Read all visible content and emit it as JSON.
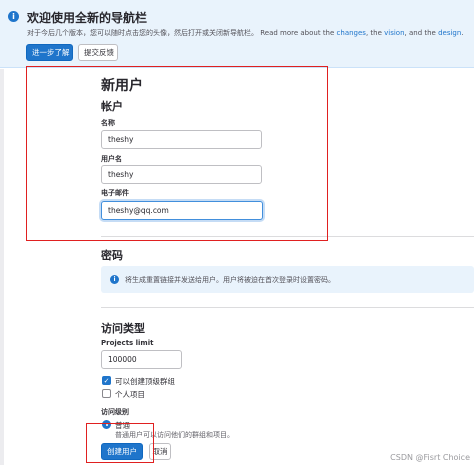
{
  "banner": {
    "title": "欢迎使用全新的导航栏",
    "text_prefix": "对于今后几个版本，您可以随时点击您的头像，然后打开或关闭新导航栏。 Read more about the ",
    "link_changes": "changes",
    "text_mid1": ", the ",
    "link_vision": "vision",
    "text_mid2": ", and the ",
    "link_design": "design",
    "text_end": ".",
    "learn_more_button": "进一步了解",
    "feedback_button": "提交反馈"
  },
  "form": {
    "title": "新用户",
    "account_section": "帐户",
    "name_label": "名称",
    "name_value": "theshy",
    "username_label": "用户名",
    "username_value": "theshy",
    "email_label": "电子邮件",
    "email_value": "theshy@qq.com",
    "password_section": "密码",
    "password_notice": "将生成重置链接并发送给用户。用户将被迫在首次登录时设置密码。",
    "access_section": "访问类型",
    "projects_limit_label": "Projects limit",
    "projects_limit_value": "100000",
    "can_create_group_label": "可以创建顶级群组",
    "external_label": "个人项目",
    "access_level_label": "访问级别",
    "regular_label": "普通",
    "regular_desc": "普通用户可以访问他们的群组和项目。",
    "create_button": "创建用户",
    "cancel_button": "取消"
  },
  "checkbox_states": {
    "can_create_group": true,
    "external": false
  },
  "colors": {
    "primary": "#1f75cb",
    "annotation": "#e02020",
    "banner_bg": "#e9f3fc"
  },
  "watermark": "CSDN @Fisrt Choice"
}
